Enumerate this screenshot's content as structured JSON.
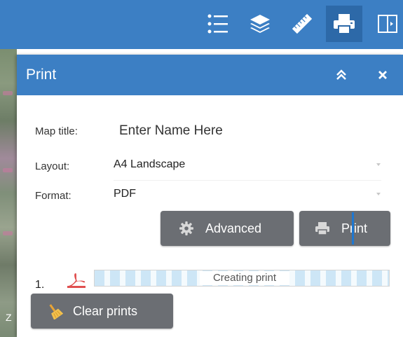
{
  "toolbar": {
    "icons": [
      "legend-list-icon",
      "layers-icon",
      "measure-ruler-icon",
      "printer-icon",
      "split-panel-icon"
    ],
    "active": "printer-icon",
    "color": "#3c7fc4"
  },
  "panel": {
    "title": "Print",
    "collapse_icon": "double-chevron-up-icon",
    "close_icon": "close-icon"
  },
  "form": {
    "map_title_label": "Map title:",
    "map_title_placeholder": "Enter Name Here",
    "map_title_value": "",
    "layout_label": "Layout:",
    "layout_value": "A4 Landscape",
    "format_label": "Format:",
    "format_value": "PDF"
  },
  "buttons": {
    "advanced_label": "Advanced",
    "advanced_icon": "gear-icon",
    "print_label": "Print",
    "print_icon": "printer-icon",
    "clear_label": "Clear prints",
    "clear_icon": "broom-icon"
  },
  "prints": [
    {
      "number": "1.",
      "file_icon": "pdf-icon",
      "status": "Creating print",
      "progress": 1.0
    }
  ],
  "map": {
    "corner_label": "Z"
  },
  "colors": {
    "header_blue": "#3c7fc4",
    "button_gray": "#6b6e73",
    "pdf_red": "#e05050"
  }
}
